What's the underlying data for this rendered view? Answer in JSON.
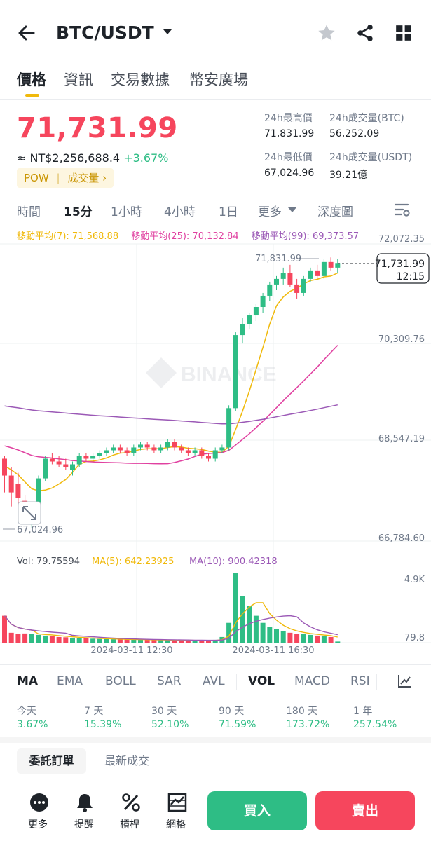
{
  "header": {
    "pair": "BTC/USDT"
  },
  "tabs": [
    "價格",
    "資訊",
    "交易數據",
    "幣安廣場"
  ],
  "price": {
    "last": "71,731.99",
    "fiat": "≈ NT$2,256,688.4",
    "change": "+3.67%",
    "tag_pow": "POW",
    "tag_vol": "成交量 ›"
  },
  "stats": {
    "high_label": "24h最高價",
    "high": "71,831.99",
    "vol_btc_label": "24h成交量(BTC)",
    "vol_btc": "56,252.09",
    "low_label": "24h最低價",
    "low": "67,024.96",
    "vol_usdt_label": "24h成交量(USDT)",
    "vol_usdt": "39.21億"
  },
  "timeframes": [
    "時間",
    "15分",
    "1小時",
    "4小時",
    "1日",
    "更多",
    "深度圖"
  ],
  "ma": {
    "ma7": "移動平均(7): 71,568.88",
    "ma25": "移動平均(25): 70,132.84",
    "ma99": "移動平均(99): 69,373.57"
  },
  "chart_data": {
    "type": "candlestick",
    "interval": "15分",
    "y_ticks": [
      "72,072.35",
      "70,309.76",
      "68,547.19",
      "66,784.60"
    ],
    "ylim": [
      66784.6,
      72072.35
    ],
    "high_marker": "71,831.99",
    "low_marker": "67,024.96",
    "last_price": "71,731.99",
    "countdown": "12:15",
    "candles": [
      [
        68250,
        68300,
        67650,
        67950
      ],
      [
        67950,
        68100,
        67400,
        67650
      ],
      [
        67800,
        68000,
        67450,
        67550
      ],
      [
        67500,
        67600,
        67150,
        67250
      ],
      [
        67200,
        67450,
        67024.96,
        67300
      ],
      [
        67300,
        67950,
        67200,
        67900
      ],
      [
        67900,
        68300,
        67850,
        68250
      ],
      [
        68250,
        68350,
        68150,
        68200
      ],
      [
        68200,
        68300,
        68100,
        68150
      ],
      [
        68150,
        68250,
        68050,
        68100
      ],
      [
        68050,
        68200,
        67950,
        68150
      ],
      [
        68150,
        68350,
        68100,
        68300
      ],
      [
        68300,
        68350,
        68200,
        68250
      ],
      [
        68250,
        68350,
        68200,
        68300
      ],
      [
        68300,
        68400,
        68250,
        68350
      ],
      [
        68350,
        68450,
        68300,
        68400
      ],
      [
        68400,
        68500,
        68350,
        68450
      ],
      [
        68450,
        68500,
        68350,
        68400
      ],
      [
        68400,
        68450,
        68300,
        68350
      ],
      [
        68350,
        68500,
        68300,
        68450
      ],
      [
        68450,
        68550,
        68400,
        68500
      ],
      [
        68500,
        68550,
        68400,
        68450
      ],
      [
        68450,
        68500,
        68350,
        68400
      ],
      [
        68400,
        68500,
        68350,
        68450
      ],
      [
        68450,
        68600,
        68400,
        68550
      ],
      [
        68550,
        68600,
        68400,
        68450
      ],
      [
        68450,
        68500,
        68350,
        68400
      ],
      [
        68400,
        68450,
        68300,
        68350
      ],
      [
        68350,
        68450,
        68300,
        68400
      ],
      [
        68400,
        68450,
        68250,
        68300
      ],
      [
        68300,
        68350,
        68200,
        68250
      ],
      [
        68250,
        68450,
        68200,
        68400
      ],
      [
        68400,
        68500,
        68350,
        68450
      ],
      [
        68450,
        69200,
        68400,
        69150
      ],
      [
        69150,
        70500,
        69100,
        70450
      ],
      [
        70450,
        70750,
        70300,
        70650
      ],
      [
        70650,
        70850,
        70550,
        70800
      ],
      [
        70800,
        71000,
        70700,
        70950
      ],
      [
        70950,
        71200,
        70850,
        71150
      ],
      [
        71150,
        71400,
        71050,
        71350
      ],
      [
        71350,
        71500,
        71250,
        71450
      ],
      [
        71450,
        71650,
        71350,
        71550
      ],
      [
        71550,
        71700,
        71300,
        71350
      ],
      [
        71350,
        71450,
        71100,
        71200
      ],
      [
        71200,
        71500,
        71150,
        71450
      ],
      [
        71450,
        71650,
        71400,
        71600
      ],
      [
        71600,
        71700,
        71450,
        71500
      ],
      [
        71500,
        71800,
        71450,
        71750
      ],
      [
        71750,
        71831.99,
        71600,
        71650
      ],
      [
        71650,
        71800,
        71550,
        71731.99
      ]
    ],
    "volume": {
      "label": "Vol: 79.75594",
      "ma5": "MA(5): 642.23925",
      "ma10": "MA(10): 900.42318",
      "y_ticks": [
        "4.9K",
        "79.8"
      ],
      "values": [
        1900,
        700,
        600,
        650,
        600,
        550,
        500,
        450,
        400,
        380,
        350,
        330,
        300,
        280,
        260,
        250,
        240,
        230,
        220,
        210,
        200,
        200,
        190,
        180,
        180,
        170,
        160,
        160,
        150,
        150,
        140,
        200,
        400,
        1400,
        4900,
        3300,
        2600,
        1900,
        1400,
        1100,
        950,
        800,
        700,
        600,
        600,
        550,
        500,
        450,
        400,
        80
      ],
      "x_labels": [
        "2024-03-11 12:30",
        "2024-03-11 16:30"
      ]
    }
  },
  "indicators": [
    "MA",
    "EMA",
    "BOLL",
    "SAR",
    "AVL",
    "VOL",
    "MACD",
    "RSI"
  ],
  "performance": [
    {
      "label": "今天",
      "value": "3.67%"
    },
    {
      "label": "7 天",
      "value": "15.39%"
    },
    {
      "label": "30 天",
      "value": "52.10%"
    },
    {
      "label": "90 天",
      "value": "71.59%"
    },
    {
      "label": "180 天",
      "value": "173.72%"
    },
    {
      "label": "1 年",
      "value": "257.54%"
    }
  ],
  "order_tabs": [
    "委託訂單",
    "最新成交"
  ],
  "footer": {
    "more": "更多",
    "alert": "提醒",
    "leverage": "槓桿",
    "grid": "網格",
    "buy": "買入",
    "sell": "賣出"
  },
  "colors": {
    "up": "#2ebd85",
    "down": "#f6465d",
    "accent": "#f0b90b",
    "ma7": "#f0b90b",
    "ma25": "#e040a0",
    "ma99": "#9b59b6"
  }
}
